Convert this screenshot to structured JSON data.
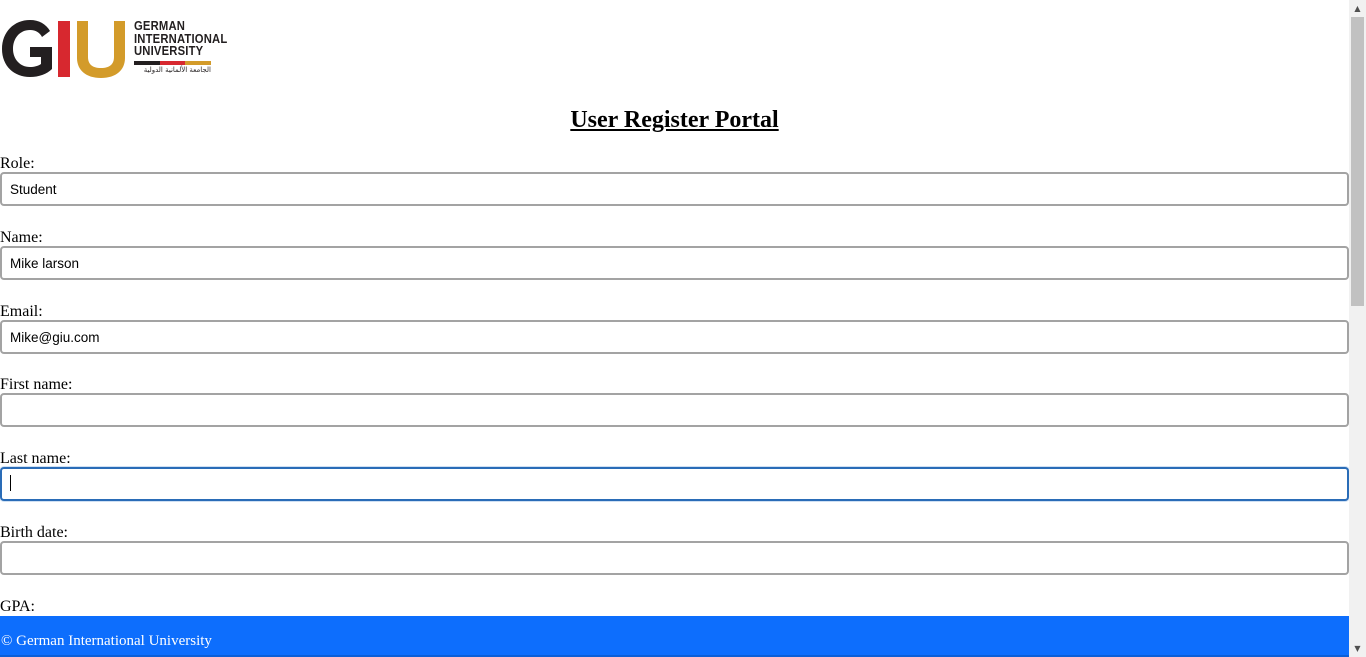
{
  "logo": {
    "letters": "GIU",
    "line1": "GERMAN",
    "line2": "INTERNATIONAL",
    "line3": "UNIVERSITY",
    "arabic": "الجامعة الألمانية الدولية",
    "colors": {
      "dark": "#231f20",
      "red": "#d7282f",
      "gold": "#d39b2a"
    }
  },
  "page_title": "User Register Portal",
  "form": {
    "role": {
      "label": "Role:",
      "value": "Student"
    },
    "name": {
      "label": "Name:",
      "value": "Mike larson"
    },
    "email": {
      "label": "Email:",
      "value": "Mike@giu.com"
    },
    "first_name": {
      "label": "First name:",
      "value": ""
    },
    "last_name": {
      "label": "Last name:",
      "value": ""
    },
    "birth_date": {
      "label": "Birth date:",
      "value": ""
    },
    "gpa": {
      "label": "GPA:"
    }
  },
  "footer": {
    "text": "© German International University",
    "color": "#0d6efd"
  },
  "scrollbar": {
    "up_icon": "scroll-up-arrow-icon",
    "down_icon": "scroll-down-arrow-icon"
  }
}
